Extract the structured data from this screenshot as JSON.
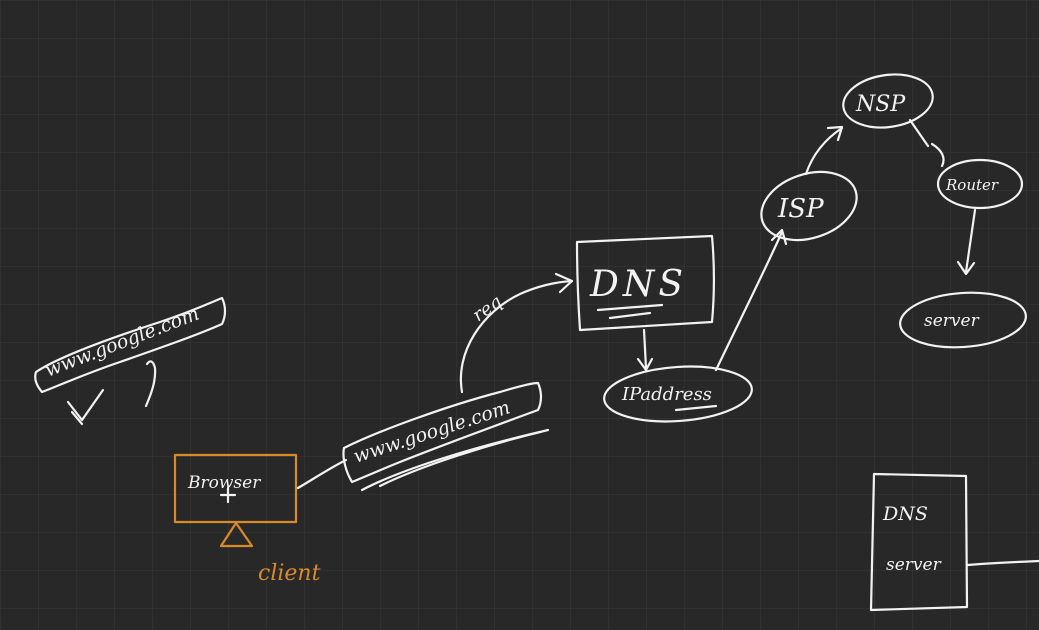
{
  "labels": {
    "url_left": "www.google.com",
    "url_center": "www.google.com",
    "browser": "Browser",
    "client": "client",
    "req": "req",
    "dns": "DNS",
    "ip_address": "IPaddress",
    "isp": "ISP",
    "nsp": "NSP",
    "router": "Router",
    "server": "server",
    "dns_server_line1": "DNS",
    "dns_server_line2": "server"
  },
  "colors": {
    "ink": "#f2f2f2",
    "accent": "#d98a2b",
    "board": "#282828"
  }
}
